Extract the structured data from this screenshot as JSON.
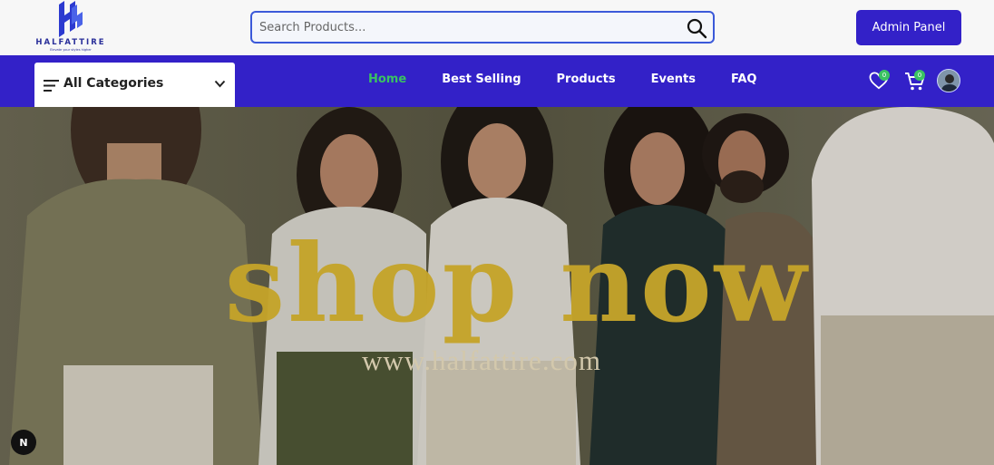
{
  "brand": {
    "name": "HALFATTIRE",
    "tagline": "Elevate your styles higher",
    "primary_color": "#3321c8",
    "accent_color": "#3ac262"
  },
  "search": {
    "placeholder": "Search Products...",
    "icon": "search-icon"
  },
  "header": {
    "admin_label": "Admin Panel"
  },
  "categories": {
    "label": "All Categories",
    "icon": "menu-icon"
  },
  "nav": {
    "items": [
      {
        "label": "Home",
        "active": true
      },
      {
        "label": "Best Selling",
        "active": false
      },
      {
        "label": "Products",
        "active": false
      },
      {
        "label": "Events",
        "active": false
      },
      {
        "label": "FAQ",
        "active": false
      }
    ]
  },
  "icons": {
    "wishlist": {
      "icon": "heart-icon",
      "count": "0"
    },
    "cart": {
      "icon": "cart-icon",
      "count": "0"
    },
    "profile": {
      "icon": "user-avatar"
    }
  },
  "hero": {
    "title": "shop now",
    "url": "www.halfattire.com",
    "title_color": "#c5a42a"
  },
  "dev_badge": {
    "label": "N"
  }
}
